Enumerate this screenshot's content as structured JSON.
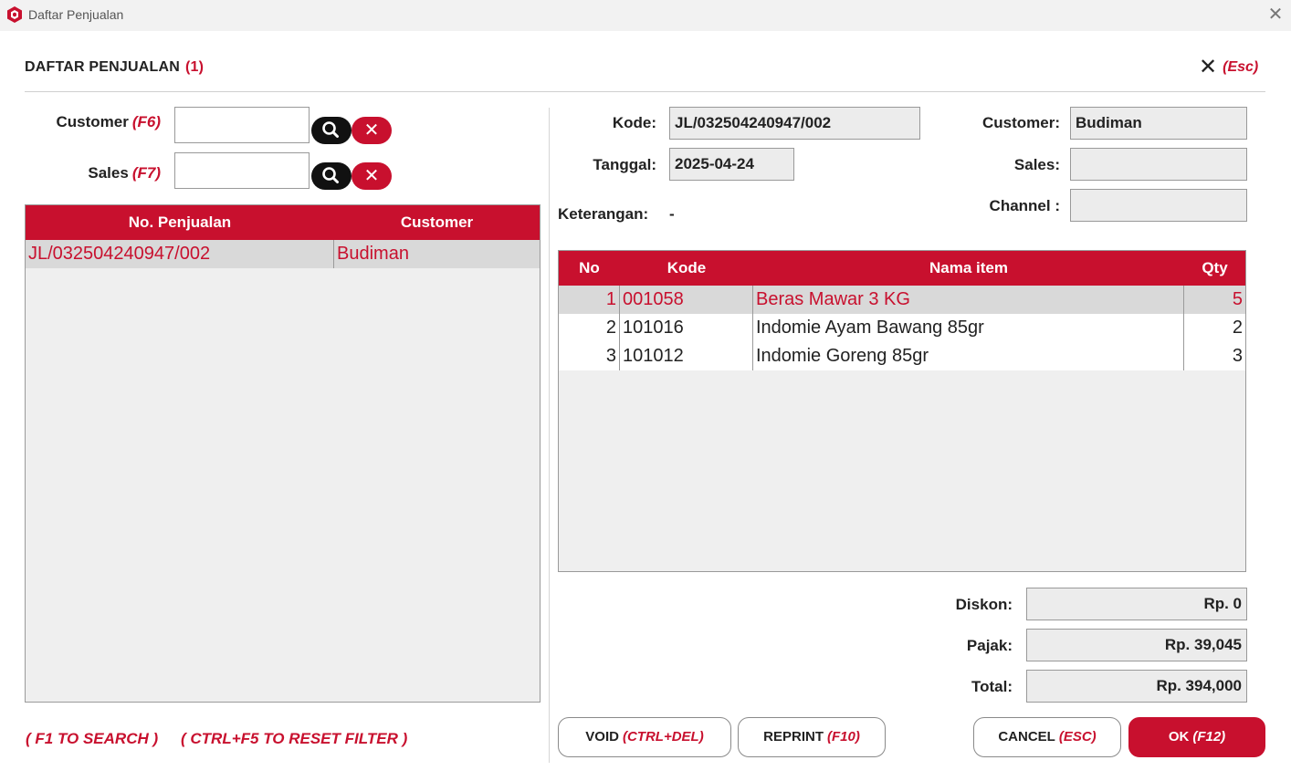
{
  "window": {
    "title": "Daftar Penjualan",
    "close_glyph": "✕"
  },
  "dialog": {
    "title": "DAFTAR PENJUALAN",
    "count": "(1)",
    "close_key": "(Esc)"
  },
  "filters": {
    "customer": {
      "label": "Customer",
      "shortcut": "(F6)",
      "value": ""
    },
    "sales": {
      "label": "Sales",
      "shortcut": "(F7)",
      "value": ""
    }
  },
  "sales_list": {
    "headers": [
      "No. Penjualan",
      "Customer"
    ],
    "rows": [
      {
        "no": "JL/032504240947/002",
        "customer": "Budiman"
      }
    ]
  },
  "detail": {
    "kode_label": "Kode:",
    "kode": "JL/032504240947/002",
    "tanggal_label": "Tanggal:",
    "tanggal": "2025-04-24",
    "keterangan_label": "Keterangan:",
    "keterangan": "-",
    "customer_label": "Customer:",
    "customer": "Budiman",
    "sales_label": "Sales:",
    "sales": "",
    "channel_label": "Channel :",
    "channel": ""
  },
  "items": {
    "headers": [
      "No",
      "Kode",
      "Nama item",
      "Qty"
    ],
    "rows": [
      {
        "no": "1",
        "kode": "001058",
        "nama": "Beras Mawar 3 KG",
        "qty": "5"
      },
      {
        "no": "2",
        "kode": "101016",
        "nama": "Indomie Ayam Bawang 85gr",
        "qty": "2"
      },
      {
        "no": "3",
        "kode": "101012",
        "nama": "Indomie Goreng 85gr",
        "qty": "3"
      }
    ]
  },
  "totals": {
    "diskon_label": "Diskon:",
    "diskon": "Rp. 0",
    "pajak_label": "Pajak:",
    "pajak": "Rp. 39,045",
    "total_label": "Total:",
    "total": "Rp. 394,000"
  },
  "hints": {
    "search": "( F1 TO SEARCH )",
    "reset": "( CTRL+F5 TO RESET FILTER )"
  },
  "buttons": {
    "void": {
      "label": "VOID",
      "key": "(CTRL+DEL)"
    },
    "reprint": {
      "label": "REPRINT",
      "key": "(F10)"
    },
    "cancel": {
      "label": "CANCEL",
      "key": "(ESC)"
    },
    "ok": {
      "label": "OK",
      "key": "(F12)"
    }
  },
  "colors": {
    "accent": "#c8102e",
    "selected_row": "#d9d9d9",
    "field_bg": "#ececec"
  },
  "icons": [
    "app-logo-icon",
    "close-icon",
    "search-icon",
    "clear-icon"
  ]
}
